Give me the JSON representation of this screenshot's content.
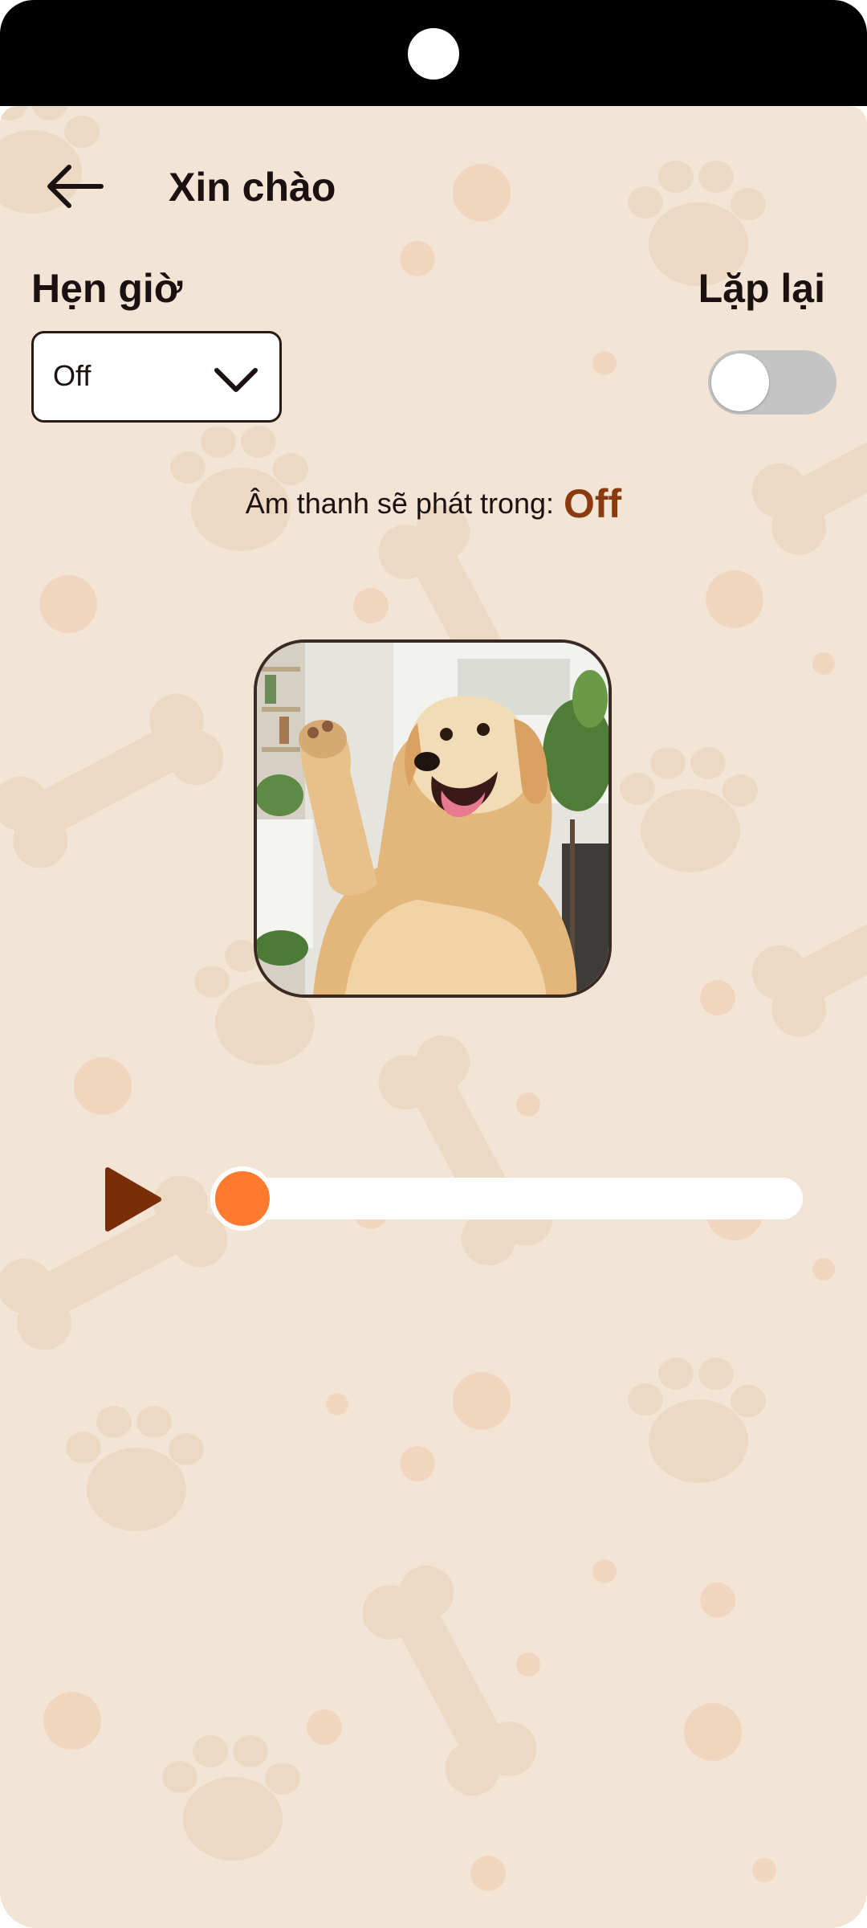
{
  "header": {
    "back_icon": "arrow-left-icon",
    "title": "Xin chào"
  },
  "timer": {
    "label": "Hẹn giờ",
    "selected": "Off",
    "chevron_icon": "chevron-down-icon"
  },
  "repeat": {
    "label": "Lặp lại",
    "enabled": false
  },
  "countdown": {
    "prefix": "Âm thanh sẽ phát trong:",
    "value": "Off"
  },
  "player": {
    "play_icon": "play-icon",
    "progress": 0.0
  },
  "colors": {
    "background": "#f3e5d5",
    "pattern": "#ead5bd",
    "accent": "#ff7a2e",
    "countdown": "#8a3a0e",
    "play": "#7a2e08",
    "toggle_off": "#c4c4c4"
  }
}
